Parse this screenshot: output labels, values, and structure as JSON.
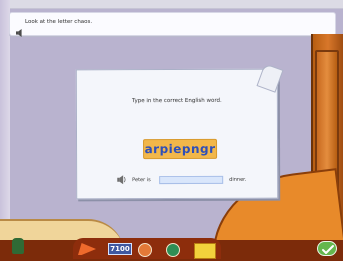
{
  "instruction": "Look at the letter chaos.",
  "task_prompt": "Type in the correct English word.",
  "scrambled_word": "arpiepngr",
  "sentence": {
    "before": "Peter is",
    "after": "dinner.",
    "answer_placeholder": ""
  },
  "toolbar": {
    "counter_value": "7100"
  },
  "colors": {
    "background": "#b9b3cf",
    "word_highlight": "#f2b74a",
    "word_text": "#2e4fb8",
    "input_fill": "#d9e6fb",
    "check_button": "#64b64d"
  },
  "icons": {
    "instruction_audio": "speaker-icon",
    "sentence_audio": "speaker-icon",
    "submit": "checkmark-icon"
  }
}
